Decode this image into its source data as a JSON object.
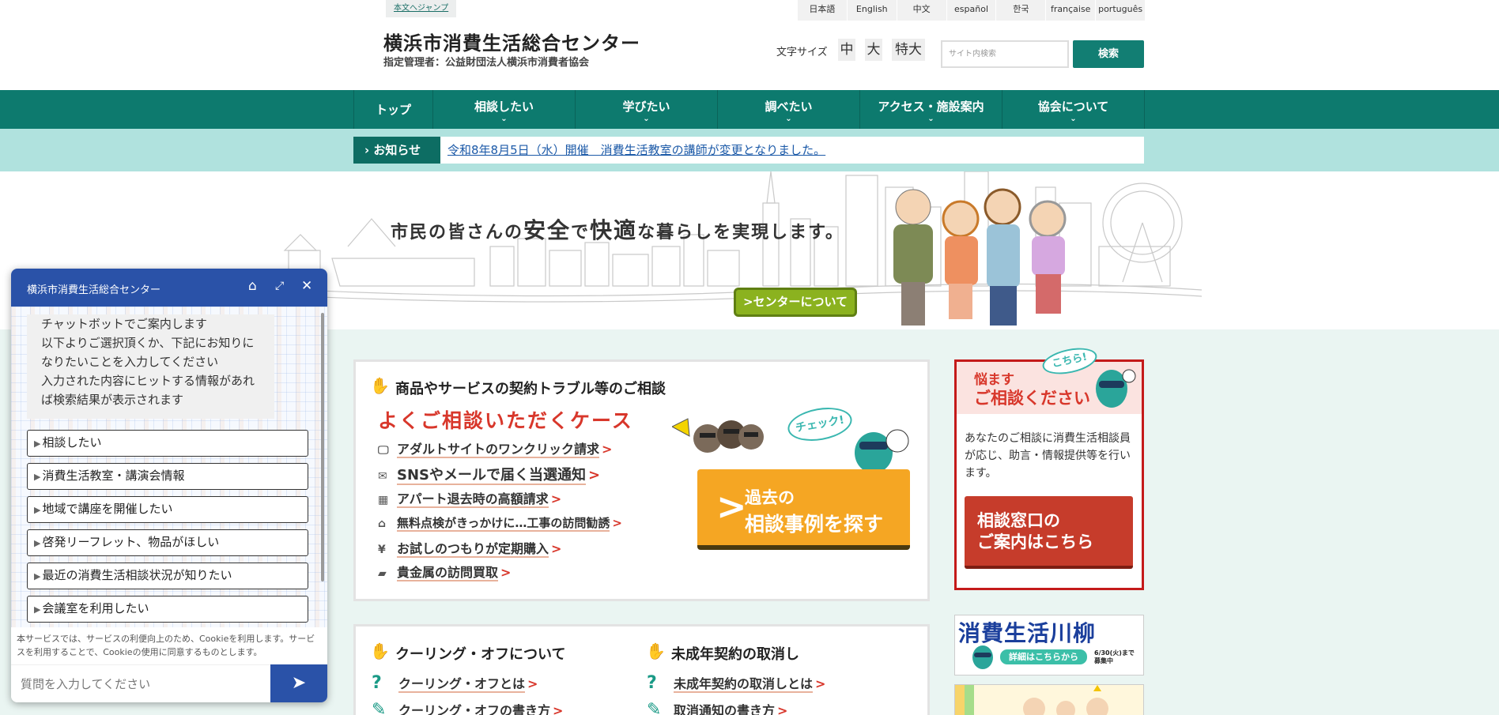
{
  "header": {
    "skip_link": "本文へジャンプ",
    "languages": [
      "日本語",
      "English",
      "中文",
      "español",
      "한국",
      "française",
      "português"
    ],
    "site_title": "横浜市消費生活総合センター",
    "site_subtitle": "指定管理者：公益財団法人横浜市消費者協会",
    "text_size_label": "文字サイズ",
    "text_sizes": [
      "中",
      "大",
      "特大"
    ],
    "search_placeholder": "サイト内検索",
    "search_button": "検索"
  },
  "nav": {
    "items": [
      "トップ",
      "相談したい",
      "学びたい",
      "調べたい",
      "アクセス・施設案内",
      "協会について"
    ],
    "chevron": "⌄"
  },
  "notice": {
    "label": "お知らせ",
    "text": "令和8年8月5日（水）開催　消費生活教室の講師が変更となりました。"
  },
  "hero": {
    "slogan_1": "市民の皆さんの",
    "slogan_em1": "安全",
    "slogan_2": "で",
    "slogan_em2": "快適",
    "slogan_3": "な暮らしを実現します。",
    "center_button": ">センターについて"
  },
  "trouble": {
    "title": "商品やサービスの契約トラブル等のご相談",
    "case_heading": "よくご相談いただくケース",
    "cases": [
      {
        "icon": "monitor-icon",
        "text": "アダルトサイトのワンクリック請求"
      },
      {
        "icon": "email-icon",
        "text": "SNSやメールで届く当選通知"
      },
      {
        "icon": "apartment-icon",
        "text": "アパート退去時の高額請求"
      },
      {
        "icon": "house-icon",
        "text": "無料点検がきっかけに…工事の訪問勧誘"
      },
      {
        "icon": "money-icon",
        "text": "お試しのつもりが定期購入"
      },
      {
        "icon": "gold-bar-icon",
        "text": "貴金属の訪問買取"
      }
    ],
    "arrow": ">",
    "check_bubble": "チェック!",
    "past_cases_line1": "過去の",
    "past_cases_line2": "相談事例を探す"
  },
  "consult": {
    "head_line1": "悩ます",
    "head_line2": "ご相談ください",
    "bubble": "こちら!",
    "description": "あなたのご相談に消費生活相談員が応じ、助言・情報提供等を行います。",
    "button_line1": "相談窓口の",
    "button_line2": "ご案内はこちら"
  },
  "senryu": {
    "title": "消費生活川柳",
    "detail": "詳細はこちらから",
    "note_line1": "6/30(火)まで",
    "note_line2": "募集中"
  },
  "cooling_off": {
    "title": "クーリング・オフについて",
    "items": [
      "クーリング・オフとは",
      "クーリング・オフの書き方"
    ]
  },
  "minor": {
    "title": "未成年契約の取消し",
    "items": [
      "未成年契約の取消しとは",
      "取消通知の書き方"
    ]
  },
  "chat": {
    "title": "横浜市消費生活総合センター",
    "intro": [
      "チャットボットでご案内します",
      "以下よりご選択頂くか、下記にお知りに",
      "なりたいことを入力してください",
      "入力された内容にヒットする情報があれ",
      "ば検索結果が表示されます"
    ],
    "options": [
      "相談したい",
      "消費生活教室・講演会情報",
      "地域で講座を開催したい",
      "啓発リーフレット、物品がほしい",
      "最近の消費生活相談状況が知りたい",
      "会議室を利用したい"
    ],
    "cookie_notice": "本サービスでは、サービスの利便向上のため、Cookieを利用します。サービスを利用することで、Cookieの使用に同意するものとします。",
    "input_placeholder": "質問を入力してください"
  },
  "colors": {
    "brand_teal": "#0d7a6e",
    "notice_band": "#b0e2de",
    "accent_red": "#d8372b",
    "chat_blue": "#2a52a8",
    "past_button_orange": "#f5a623"
  }
}
